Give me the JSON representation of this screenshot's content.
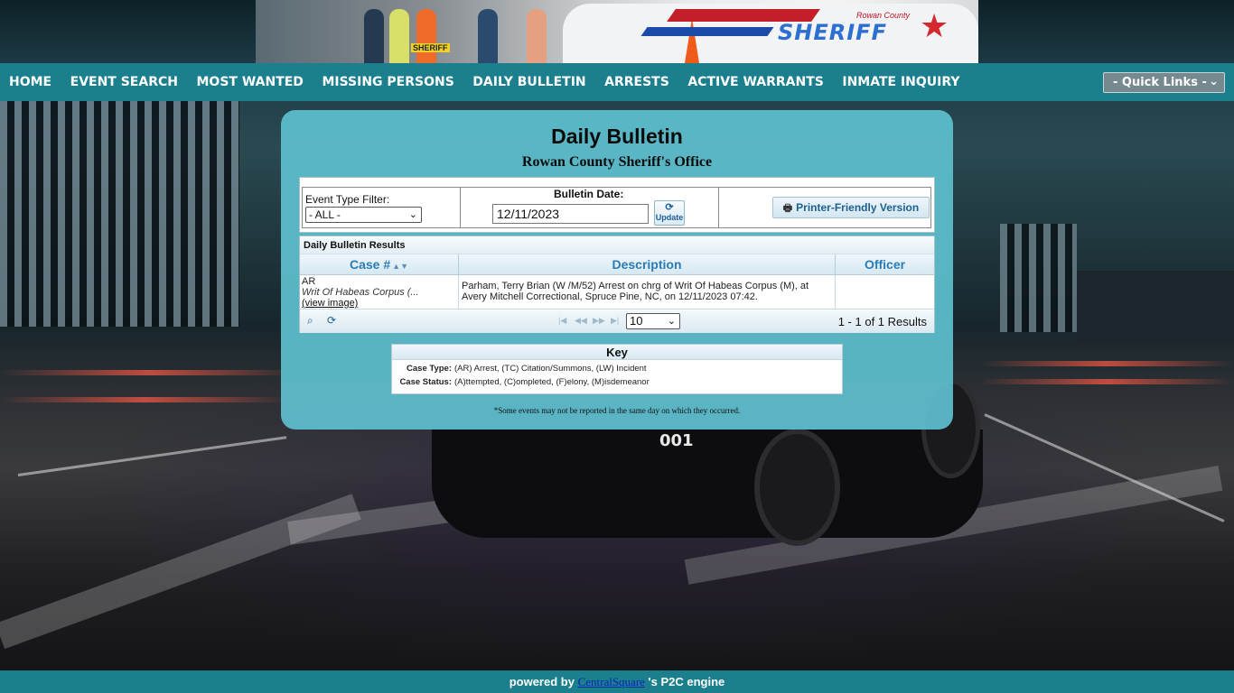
{
  "banner": {
    "sheriff_text": "SHERIFF",
    "county_text": "Rowan County",
    "badge_text": "SHERIFF"
  },
  "nav": {
    "items": [
      {
        "label": "HOME"
      },
      {
        "label": "EVENT SEARCH"
      },
      {
        "label": "MOST WANTED"
      },
      {
        "label": "MISSING PERSONS"
      },
      {
        "label": "DAILY BULLETIN"
      },
      {
        "label": "ARRESTS"
      },
      {
        "label": "ACTIVE WARRANTS"
      },
      {
        "label": "INMATE INQUIRY"
      }
    ],
    "quick_links": "- Quick Links -"
  },
  "page": {
    "title": "Daily Bulletin",
    "subtitle": "Rowan County Sheriff's Office"
  },
  "filters": {
    "event_type_label": "Event Type Filter:",
    "event_type_value": "- ALL -",
    "bulletin_date_label": "Bulletin Date:",
    "bulletin_date_value": "12/11/2023",
    "update_label": "Update",
    "printer_label": "Printer-Friendly Version"
  },
  "results": {
    "title": "Daily Bulletin Results",
    "columns": [
      "Case #",
      "Description",
      "Officer"
    ],
    "rows": [
      {
        "case_type": "AR",
        "charge": "Writ Of Habeas Corpus (...",
        "view_image": "(view image)",
        "description": "Parham, Terry Brian (W /M/52) Arrest on chrg of Writ Of Habeas Corpus (M), at Avery Mitchell Correctional, Spruce Pine, NC, on 12/11/2023 07:42.",
        "officer": ""
      }
    ],
    "page_size": "10",
    "count_text": "1 - 1 of 1 Results"
  },
  "key": {
    "title": "Key",
    "case_type_label": "Case Type:",
    "case_type_text": "(AR) Arrest, (TC) Citation/Summons, (LW) Incident",
    "case_status_label": "Case Status:",
    "case_status_text": "(A)ttempted, (C)ompleted, (F)elony, (M)isdemeanor"
  },
  "footnote": "*Some events may not be reported in the same day on which they occurred.",
  "footer": {
    "prefix": "powered by ",
    "brand": "CentralSquare",
    "suffix": " 's P2C engine"
  },
  "colors": {
    "nav_bg": "#1b7f8e",
    "panel_bg": "#5ebece",
    "header_text": "#2b7bb5"
  }
}
